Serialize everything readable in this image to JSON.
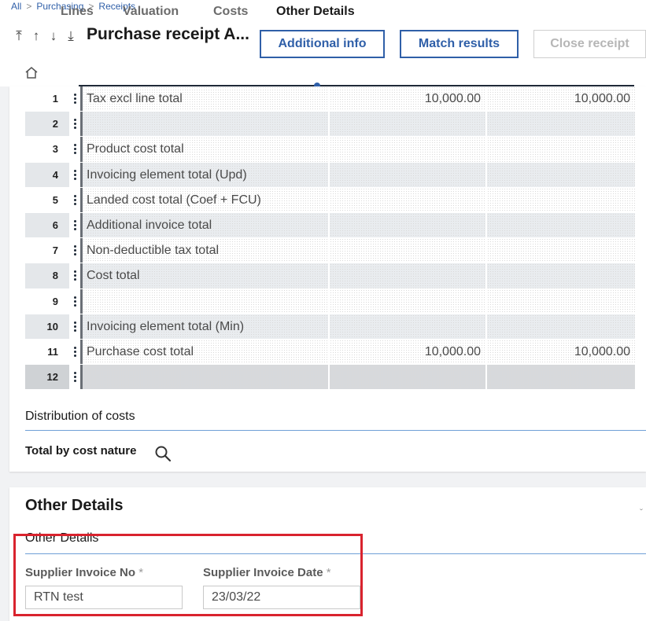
{
  "breadcrumb": [
    "All",
    "Purchasing",
    "Receipts"
  ],
  "header": {
    "title": "Purchase receipt A...",
    "buttons": {
      "additional_info": "Additional info",
      "match_results": "Match results",
      "close_receipt": "Close receipt"
    }
  },
  "tabs": [
    "Lines",
    "Valuation",
    "Costs",
    "Other Details"
  ],
  "active_tab": "Other Details",
  "grid": {
    "rows": [
      {
        "num": "1",
        "label": "Tax excl line total",
        "v1": "10,000.00",
        "v2": "10,000.00"
      },
      {
        "num": "2",
        "label": "",
        "v1": "",
        "v2": ""
      },
      {
        "num": "3",
        "label": "Product cost total",
        "v1": "",
        "v2": ""
      },
      {
        "num": "4",
        "label": "Invoicing element total (Upd)",
        "v1": "",
        "v2": ""
      },
      {
        "num": "5",
        "label": "Landed cost total (Coef + FCU)",
        "v1": "",
        "v2": ""
      },
      {
        "num": "6",
        "label": "Additional invoice total",
        "v1": "",
        "v2": ""
      },
      {
        "num": "7",
        "label": "Non-deductible tax total",
        "v1": "",
        "v2": ""
      },
      {
        "num": "8",
        "label": "Cost total",
        "v1": "",
        "v2": ""
      },
      {
        "num": "9",
        "label": "",
        "v1": "",
        "v2": ""
      },
      {
        "num": "10",
        "label": "Invoicing element total (Min)",
        "v1": "",
        "v2": ""
      },
      {
        "num": "11",
        "label": "Purchase cost total",
        "v1": "10,000.00",
        "v2": "10,000.00"
      },
      {
        "num": "12",
        "label": "",
        "v1": "",
        "v2": ""
      }
    ]
  },
  "distribution": {
    "title": "Distribution of costs",
    "total_label": "Total by cost nature"
  },
  "other_details": {
    "section_title": "Other Details",
    "sub_title": "Other Details",
    "supplier_invoice_no": {
      "label": "Supplier Invoice No",
      "value": "RTN test"
    },
    "supplier_invoice_date": {
      "label": "Supplier Invoice Date",
      "value": "23/03/22"
    },
    "required_mark": "*"
  },
  "colors": {
    "accent": "#2f5fa8",
    "highlight": "#d9232e"
  }
}
